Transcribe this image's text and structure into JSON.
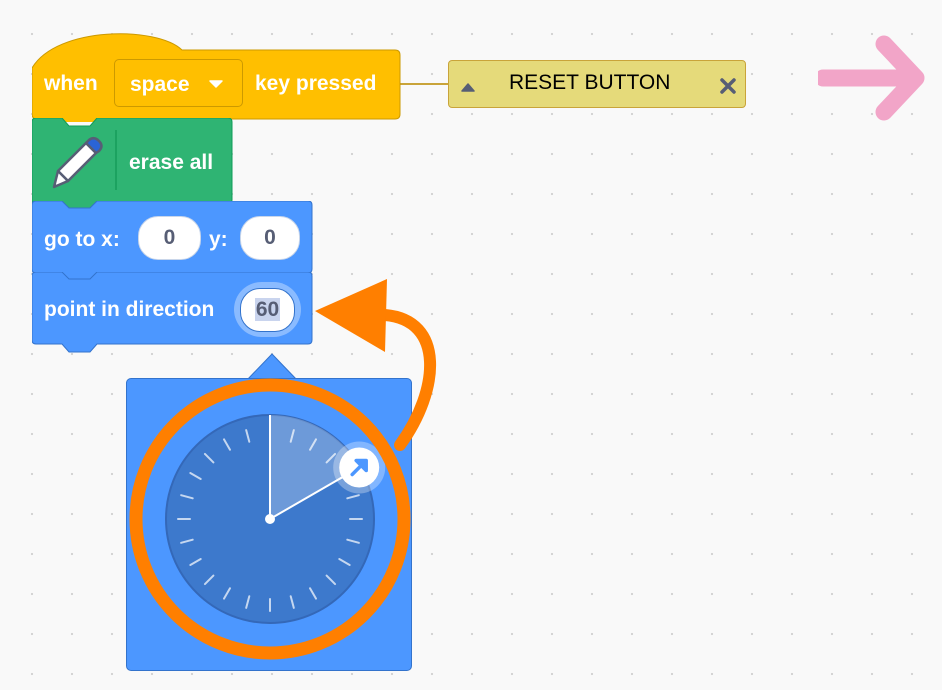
{
  "blocks": {
    "hat": {
      "word_when": "when",
      "key_dropdown": "space",
      "word_key_pressed": "key pressed",
      "color": "#ffbf00"
    },
    "erase": {
      "label": "erase all",
      "color": "#2fb473"
    },
    "goto": {
      "label_x": "go to x:",
      "x_value": "0",
      "label_y": "y:",
      "y_value": "0",
      "color": "#4c97ff"
    },
    "point": {
      "label": "point in direction",
      "value": "60",
      "color": "#4c97ff"
    }
  },
  "comment": {
    "text": "RESET BUTTON",
    "color": "#e5da7a"
  },
  "direction_picker": {
    "angle_degrees": 60,
    "background": "#4c97ff"
  },
  "annotation": {
    "accent": "#ff7f00",
    "arrow_color": "#f2a5c8"
  }
}
